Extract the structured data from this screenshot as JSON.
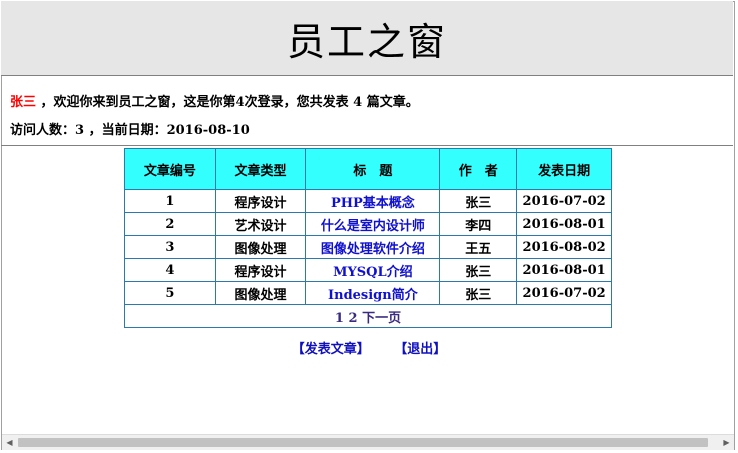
{
  "header": {
    "title": "员工之窗"
  },
  "welcome": {
    "username": "张三",
    "text_before_count": " ，欢迎你来到员工之窗，这是你第",
    "login_count": "4",
    "text_after_count": "次登录，您共发表 ",
    "article_count": "4",
    "text_end": " 篇文章。"
  },
  "stats": {
    "visitors_label": "访问人数：",
    "visitors": "3",
    "date_label": " ，当前日期：",
    "date": "2016-08-10"
  },
  "table": {
    "headers": [
      "文章编号",
      "文章类型",
      "标　题",
      "作　者",
      "发表日期"
    ],
    "rows": [
      [
        "1",
        "程序设计",
        "PHP基本概念",
        "张三",
        "2016-07-02"
      ],
      [
        "2",
        "艺术设计",
        "什么是室内设计师",
        "李四",
        "2016-08-01"
      ],
      [
        "3",
        "图像处理",
        "图像处理软件介绍",
        "王五",
        "2016-08-02"
      ],
      [
        "4",
        "程序设计",
        "MYSQL介绍",
        "张三",
        "2016-08-01"
      ],
      [
        "5",
        "图像处理",
        "Indesign简介",
        "张三",
        "2016-07-02"
      ]
    ],
    "pager": {
      "page1": "1",
      "page2": "2",
      "next": "下一页"
    }
  },
  "actions": {
    "publish": "【发表文章】",
    "logout": "【退出】"
  },
  "scrollbar": {
    "left_icon": "triangle-left-icon",
    "right_icon": "triangle-right-icon",
    "left_glyph": "◀",
    "right_glyph": "▶"
  }
}
